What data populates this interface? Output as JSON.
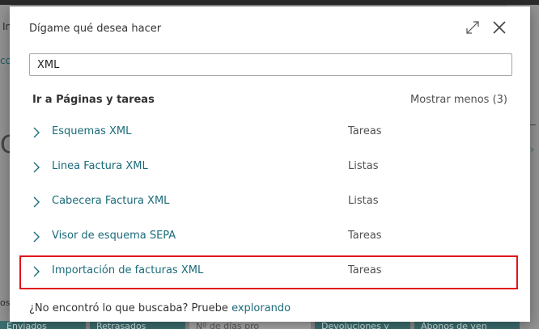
{
  "background": {
    "left_fragment_1": "In",
    "left_fragment_2": "co",
    "left_fragment_3": "C",
    "left_fragment_4": "os",
    "right_chevron": "›",
    "tiles": [
      "Enviados",
      "Retrasados",
      "Nº de días pro",
      "Devoluciones y",
      "Abonos de ven"
    ]
  },
  "dialog": {
    "title": "Dígame qué desea hacer",
    "search": {
      "value": "XML",
      "placeholder": ""
    },
    "section": {
      "title": "Ir a Páginas y tareas",
      "toggle_label": "Mostrar menos (3)"
    },
    "results": [
      {
        "name": "Esquemas XML",
        "category": "Tareas"
      },
      {
        "name": "Linea Factura XML",
        "category": "Listas"
      },
      {
        "name": "Cabecera Factura XML",
        "category": "Listas"
      },
      {
        "name": "Visor de esquema SEPA",
        "category": "Tareas"
      },
      {
        "name": "Importación de facturas XML",
        "category": "Tareas"
      }
    ],
    "footer": {
      "prefix": "¿No encontró lo que buscaba? Pruebe ",
      "link": "explorando"
    }
  },
  "icons": {
    "expand": "expand-icon",
    "close": "close-icon",
    "chevron": "chevron-right-icon"
  },
  "colors": {
    "link": "#1b6b7a",
    "highlight": "#e0141b",
    "overlay": "#8a8a8a"
  }
}
